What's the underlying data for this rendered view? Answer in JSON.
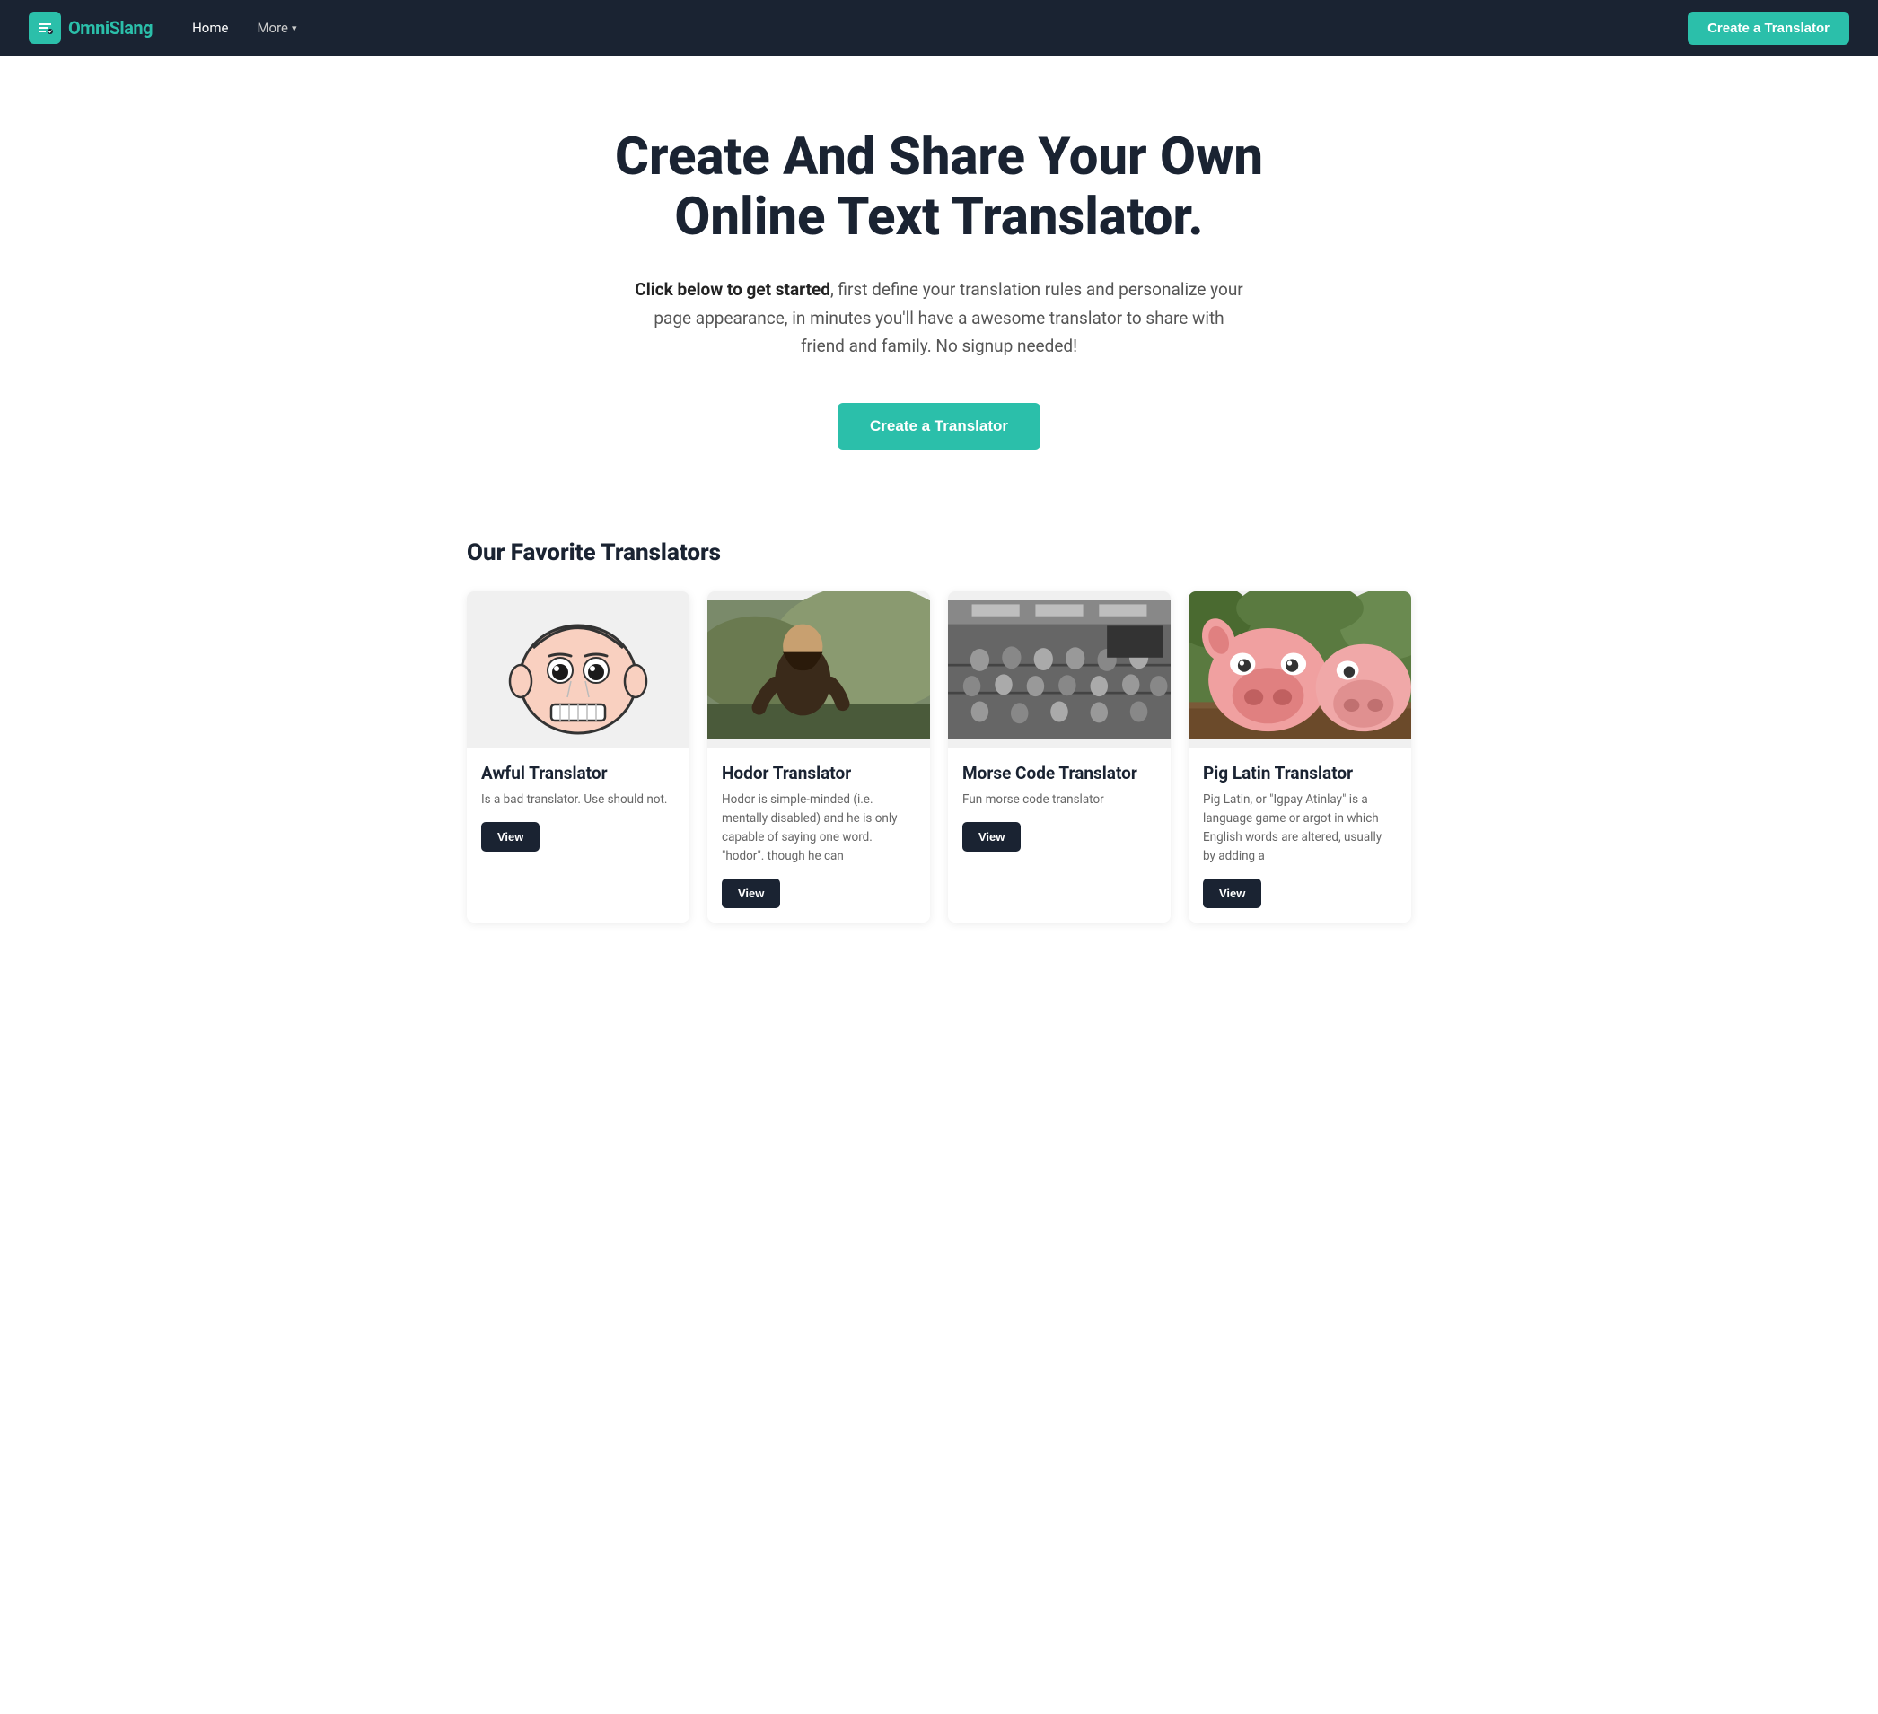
{
  "nav": {
    "logo_text": "OmniSlang",
    "logo_icon": "💬",
    "home_label": "Home",
    "more_label": "More",
    "cta_label": "Create a Translator"
  },
  "hero": {
    "title": "Create And Share Your Own Online Text Translator.",
    "subtitle_bold": "Click below to get started",
    "subtitle_rest": ", first define your translation rules and personalize your page appearance, in minutes you'll have a awesome translator to share with friend and family. No signup needed!",
    "cta_label": "Create a Translator"
  },
  "section": {
    "title": "Our Favorite Translators",
    "cards": [
      {
        "id": "awful",
        "title": "Awful Translator",
        "description": "Is a bad translator. Use should not.",
        "button_label": "View"
      },
      {
        "id": "hodor",
        "title": "Hodor Translator",
        "description": "Hodor is simple-minded (i.e. mentally disabled) and he is only capable of saying one word. \"hodor\". though he can",
        "button_label": "View"
      },
      {
        "id": "morse",
        "title": "Morse Code Translator",
        "description": "Fun morse code translator",
        "button_label": "View"
      },
      {
        "id": "pig",
        "title": "Pig Latin Translator",
        "description": "Pig Latin, or \"Igpay Atinlay\" is a language game or argot in which English words are altered, usually by adding a",
        "button_label": "View"
      }
    ]
  }
}
